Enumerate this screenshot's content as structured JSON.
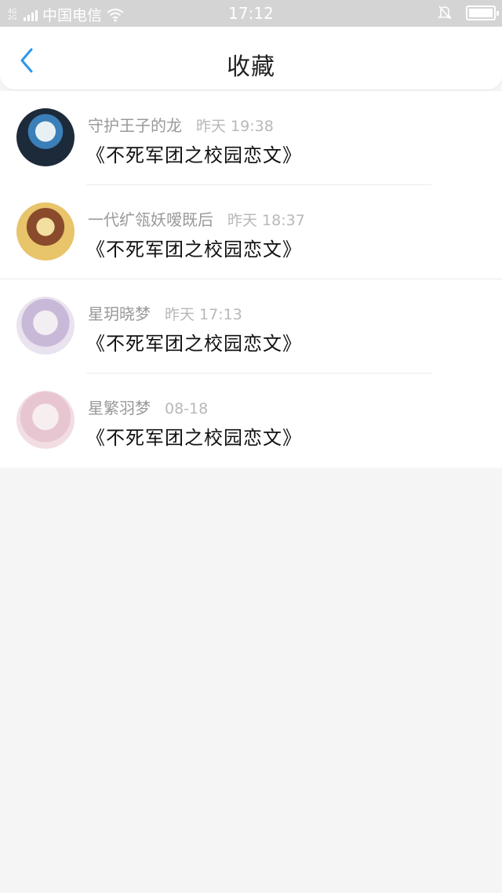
{
  "status_bar": {
    "network_tag": "4G\n2G",
    "carrier": "中国电信",
    "time": "17:12",
    "battery_level": 1.0,
    "icons": [
      "signal-bars-icon",
      "wifi-icon",
      "mute-bell-icon",
      "battery-icon"
    ]
  },
  "header": {
    "title": "收藏",
    "back_icon": "chevron-left-icon",
    "accent": "#2b98e8"
  },
  "favorites": [
    {
      "name": "守护王子的龙",
      "time": "昨天 19:38",
      "book": "《不死军团之校园恋文》",
      "avatar_colors": [
        "#1d2a3a",
        "#e8f0f4",
        "#3a7fb8"
      ]
    },
    {
      "name": "一代纩瓴妖嗳既后",
      "time": "昨天 18:37",
      "book": "《不死军团之校园恋文》",
      "avatar_colors": [
        "#e8c46a",
        "#8a4a2c",
        "#f3dfa0"
      ]
    },
    {
      "name": "星玥晓梦",
      "time": "昨天 17:13",
      "book": "《不死军团之校园恋文》",
      "avatar_colors": [
        "#e9e3ef",
        "#c9b9d8",
        "#f3eef2"
      ]
    },
    {
      "name": "星繁羽梦",
      "time": "08-18",
      "book": "《不死军团之校园恋文》",
      "avatar_colors": [
        "#f2dde3",
        "#e7c6d2",
        "#f7eef0"
      ]
    }
  ]
}
